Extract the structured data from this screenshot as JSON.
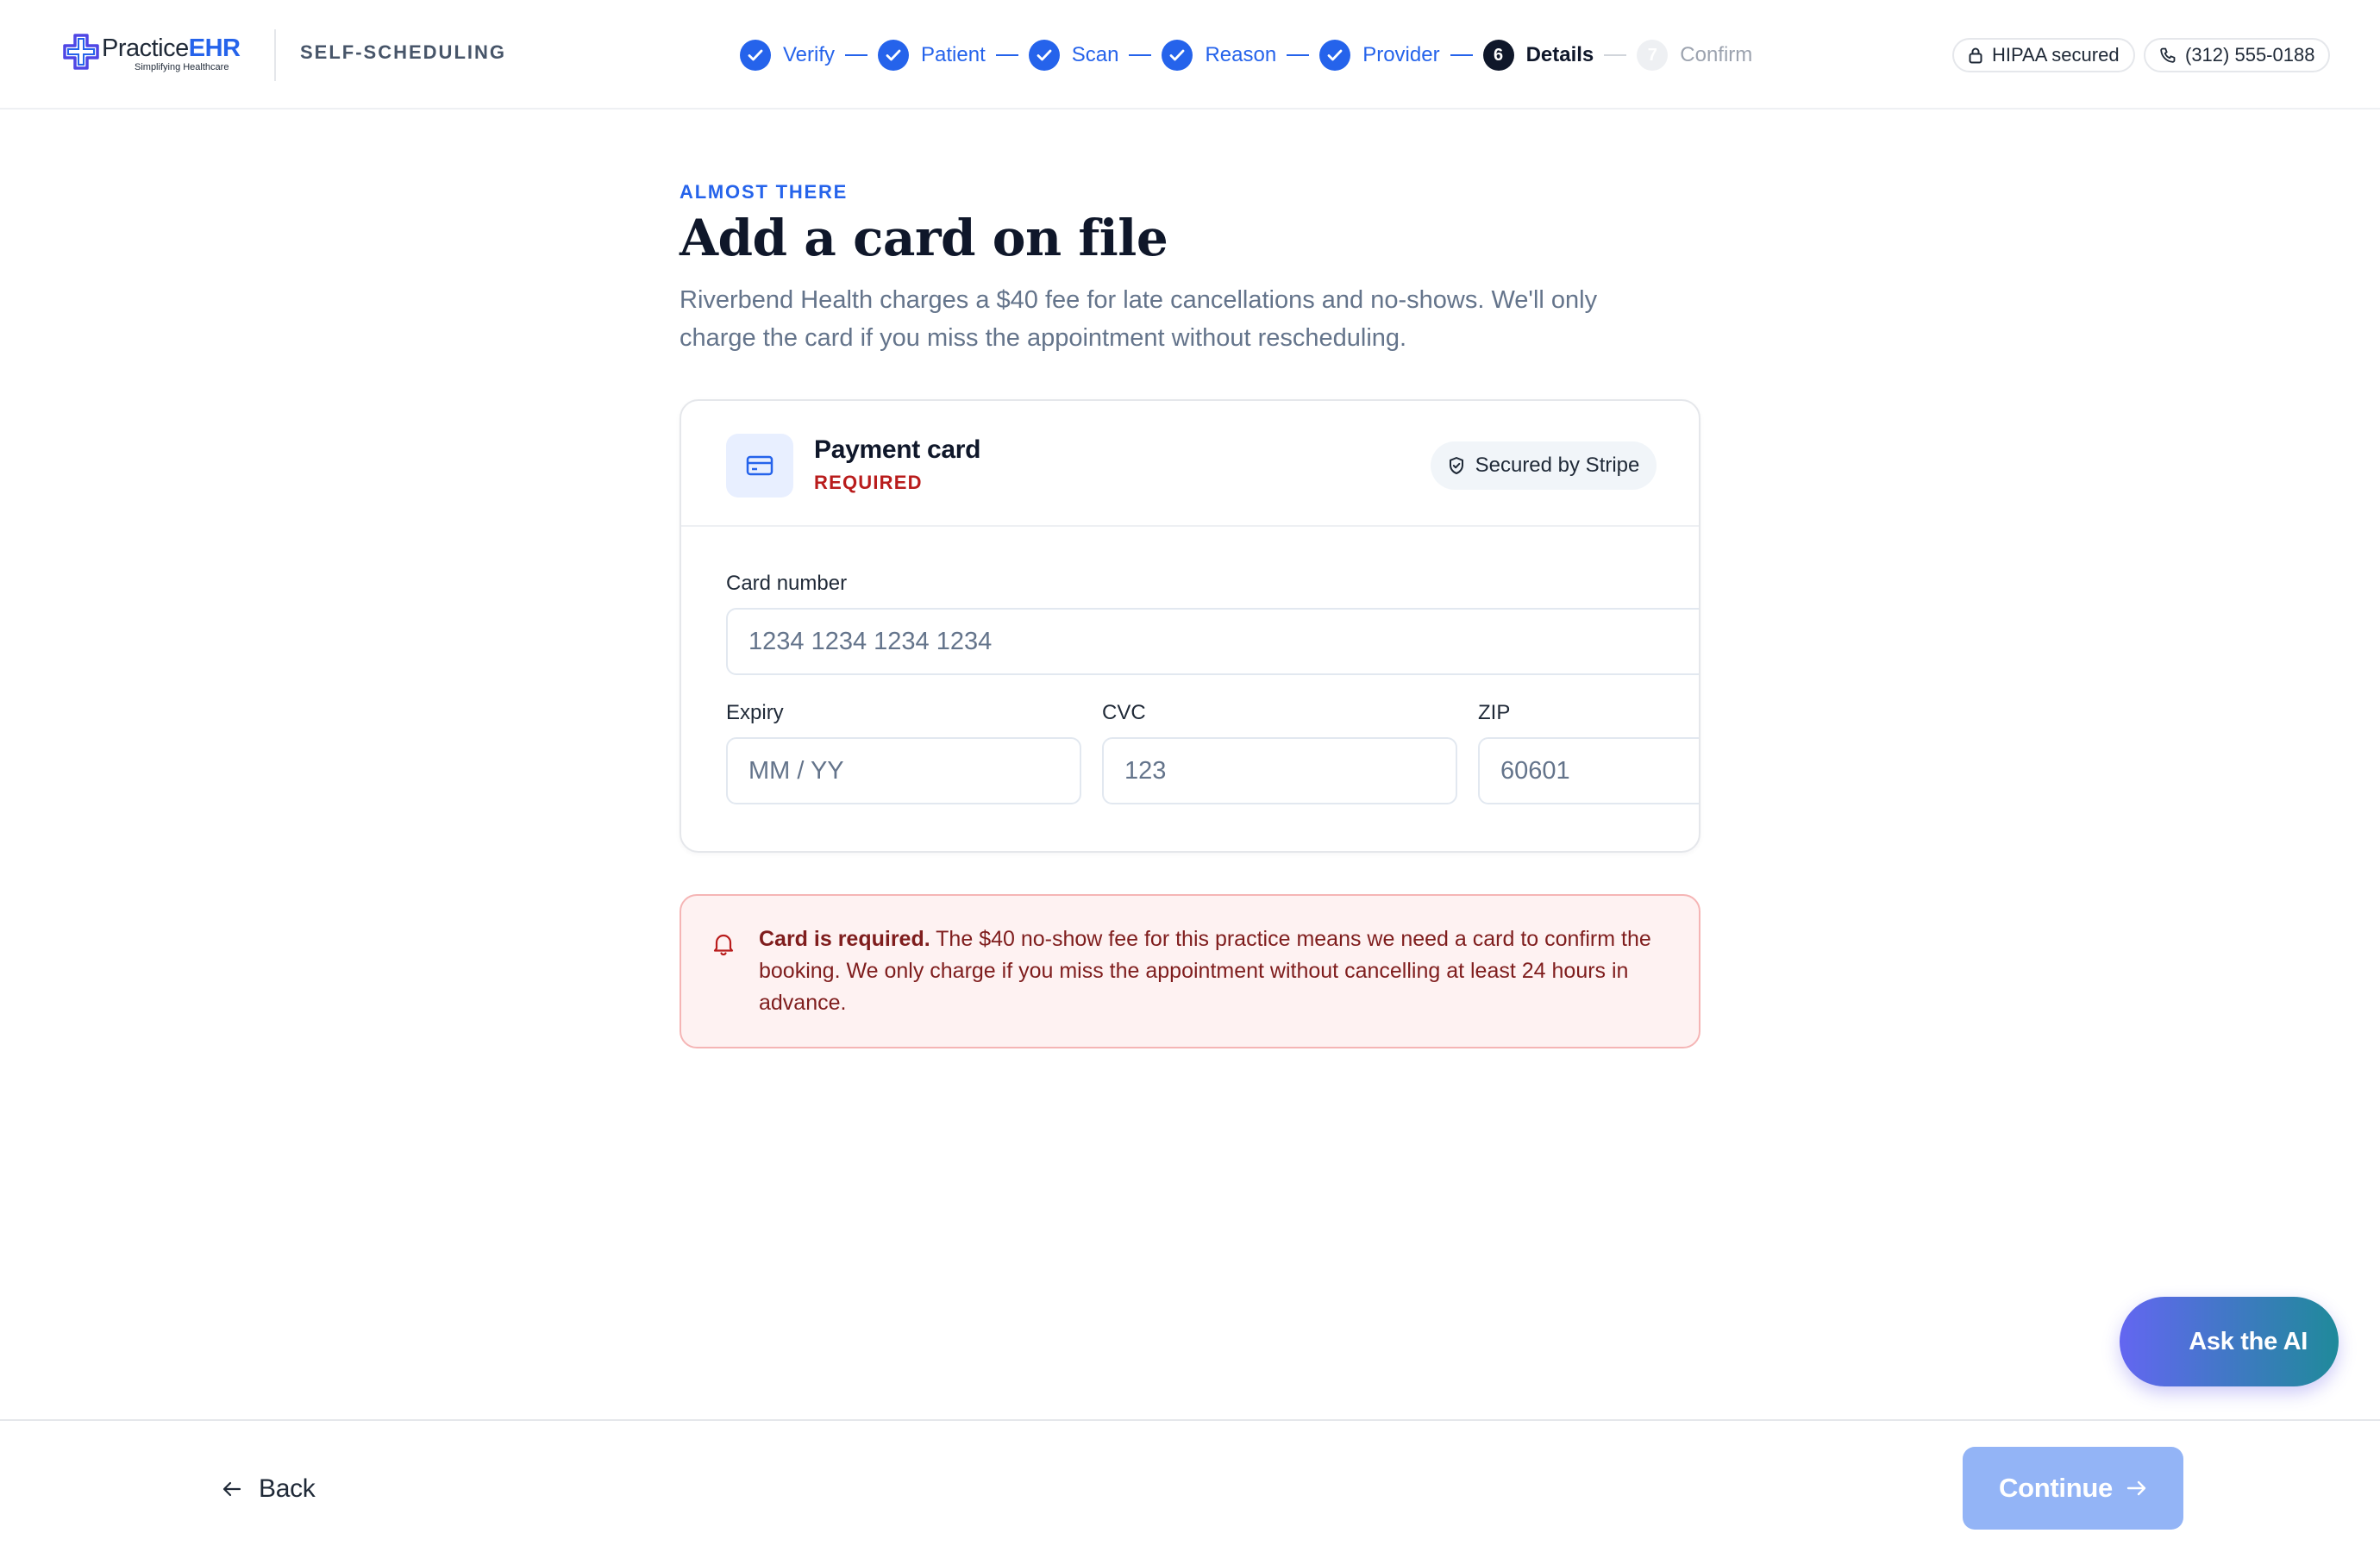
{
  "header": {
    "logo_main": "Practice",
    "logo_accent": "EHR",
    "logo_tagline": "Simplifying Healthcare",
    "section": "SELF-SCHEDULING",
    "steps": [
      {
        "label": "Verify",
        "state": "done",
        "number": "1"
      },
      {
        "label": "Patient",
        "state": "done",
        "number": "2"
      },
      {
        "label": "Scan",
        "state": "done",
        "number": "3"
      },
      {
        "label": "Reason",
        "state": "done",
        "number": "4"
      },
      {
        "label": "Provider",
        "state": "done",
        "number": "5"
      },
      {
        "label": "Details",
        "state": "current",
        "number": "6"
      },
      {
        "label": "Confirm",
        "state": "pending",
        "number": "7"
      }
    ],
    "hipaa_label": "HIPAA secured",
    "phone": "(312) 555-0188"
  },
  "main": {
    "eyebrow": "ALMOST THERE",
    "title": "Add a card on file",
    "subtitle": "Riverbend Health charges a $40 fee for late cancellations and no-shows. We'll only charge the card if you miss the appointment without rescheduling."
  },
  "card": {
    "title": "Payment card",
    "required": "REQUIRED",
    "secured_label": "Secured by Stripe",
    "fields": {
      "card_number": {
        "label": "Card number",
        "placeholder": "1234 1234 1234 1234",
        "value": ""
      },
      "expiry": {
        "label": "Expiry",
        "placeholder": "MM / YY",
        "value": ""
      },
      "cvc": {
        "label": "CVC",
        "placeholder": "123",
        "value": ""
      },
      "zip": {
        "label": "ZIP",
        "placeholder": "60601",
        "value": ""
      }
    }
  },
  "alert": {
    "strong": "Card is required.",
    "body": " The $40 no-show fee for this practice means we need a card to confirm the booking. We only charge if you miss the appointment without cancelling at least 24 hours in advance."
  },
  "ask_ai": "Ask the AI",
  "footer": {
    "back_label": "Back",
    "continue_label": "Continue"
  },
  "icons": {
    "logo": "medical-cross-icon",
    "step_done": "check-icon",
    "hipaa": "lock-icon",
    "phone": "phone-icon",
    "card": "credit-card-icon",
    "stripe": "shield-check-icon",
    "alert": "bell-icon",
    "back": "arrow-left-icon",
    "continue": "arrow-right-icon"
  },
  "colors": {
    "primary": "#2563eb",
    "current_step": "#0f172a",
    "required_red": "#b91c1c",
    "alert_bg": "#fef2f2",
    "alert_border": "#f5b5b5",
    "continue_disabled": "#93b4f6",
    "ai_gradient_start": "#6366f1",
    "ai_gradient_end": "#1f8a9a"
  }
}
